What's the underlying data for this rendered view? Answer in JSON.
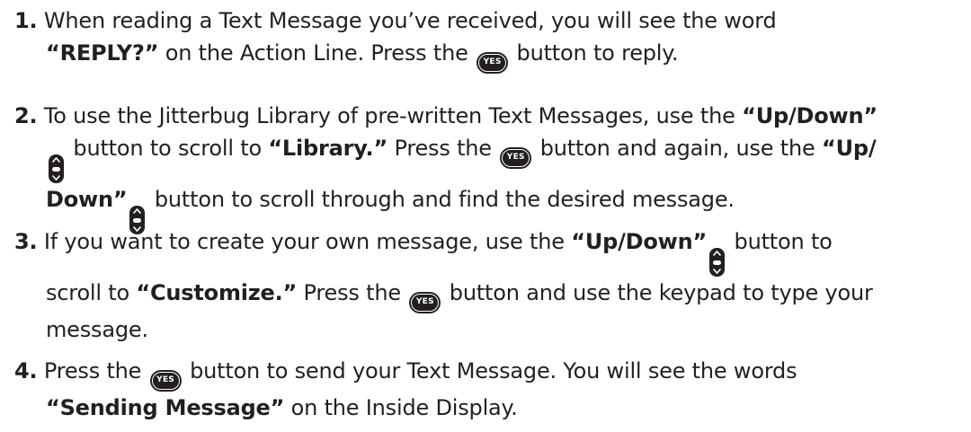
{
  "icons": {
    "yes_label": "YES",
    "yes_button": "yes-button-icon",
    "updown_button": "up-down-button-icon"
  },
  "steps": [
    {
      "number": "1.",
      "l1_t1": "When reading a Text Message you’ve received, you will see the word",
      "l2_b1": "“REPLY?”",
      "l2_t1": " on the Action Line. Press the ",
      "l2_t2": " button to reply."
    },
    {
      "number": "2.",
      "l1_t1": "To use the Jitterbug Library of pre-written Text Messages, use the ",
      "l1_b1": "“Up/Down”",
      "l2_t1": " button to scroll to ",
      "l2_b1": "“Library.”",
      "l2_t2": " Press the ",
      "l2_t3": " button and again, use the ",
      "l2_b2": "“Up/",
      "l3_b1": "Down”",
      "l3_t1": " button to scroll through and find the desired message."
    },
    {
      "number": "3.",
      "l1_t1": "If you want to create your own message, use the ",
      "l1_b1": "“Up/Down”",
      "l1_t2": " button to",
      "l2_t1": "scroll to ",
      "l2_b1": "“Customize.”",
      "l2_t2": " Press the ",
      "l2_t3": " button and use the keypad to type your",
      "l3_t1": "message."
    },
    {
      "number": "4.",
      "l1_t1": " Press the ",
      "l1_t2": " button to send your Text Message. You will see the words",
      "l2_b1": "“Sending Message”",
      "l2_t1": " on the Inside Display."
    }
  ]
}
